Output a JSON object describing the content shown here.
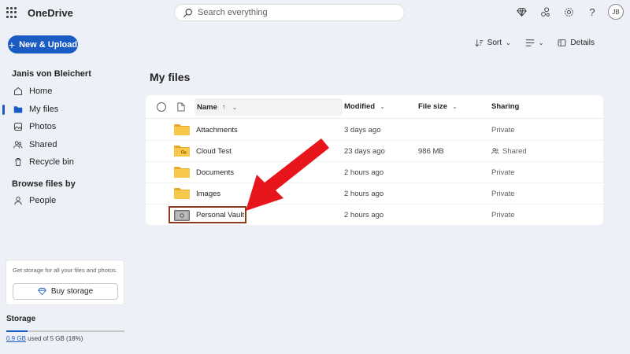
{
  "app": {
    "title": "OneDrive"
  },
  "search": {
    "placeholder": "Search everything"
  },
  "header": {
    "avatar_initials": "JB"
  },
  "sidebar": {
    "new_label": "New & Upload",
    "user_name": "Janis von Bleichert",
    "items": [
      {
        "label": "Home",
        "icon": "home-icon"
      },
      {
        "label": "My files",
        "icon": "folder-icon",
        "active": true
      },
      {
        "label": "Photos",
        "icon": "photo-icon"
      },
      {
        "label": "Shared",
        "icon": "people-icon"
      },
      {
        "label": "Recycle bin",
        "icon": "trash-icon"
      }
    ],
    "browse_title": "Browse files by",
    "browse_items": [
      {
        "label": "People",
        "icon": "person-icon"
      }
    ],
    "storage_card": {
      "message": "Get storage for all your files and photos.",
      "button_label": "Buy storage"
    },
    "storage": {
      "title": "Storage",
      "used_amount": "0.9 GB",
      "used_suffix": " used of 5 GB (18%)",
      "used_fraction": 0.18
    }
  },
  "toolbar": {
    "sort_label": "Sort",
    "details_label": "Details"
  },
  "main": {
    "title": "My files",
    "columns": {
      "name": "Name",
      "name_sort": "↑",
      "modified": "Modified",
      "size": "File size",
      "sharing": "Sharing"
    },
    "rows": [
      {
        "name": "Attachments",
        "modified": "3 days ago",
        "size": "",
        "sharing": "Private",
        "type": "folder"
      },
      {
        "name": "Cloud Test",
        "modified": "23 days ago",
        "size": "986 MB",
        "sharing": "Shared",
        "type": "shared-folder"
      },
      {
        "name": "Documents",
        "modified": "2 hours ago",
        "size": "",
        "sharing": "Private",
        "type": "folder"
      },
      {
        "name": "Images",
        "modified": "2 hours ago",
        "size": "",
        "sharing": "Private",
        "type": "folder"
      },
      {
        "name": "Personal Vault",
        "modified": "2 hours ago",
        "size": "",
        "sharing": "Private",
        "type": "vault"
      }
    ]
  },
  "colors": {
    "accent": "#1a5bc4",
    "folder": "#f8c84b",
    "arrow": "#e8141c",
    "highlight": "#8b3a1e"
  }
}
